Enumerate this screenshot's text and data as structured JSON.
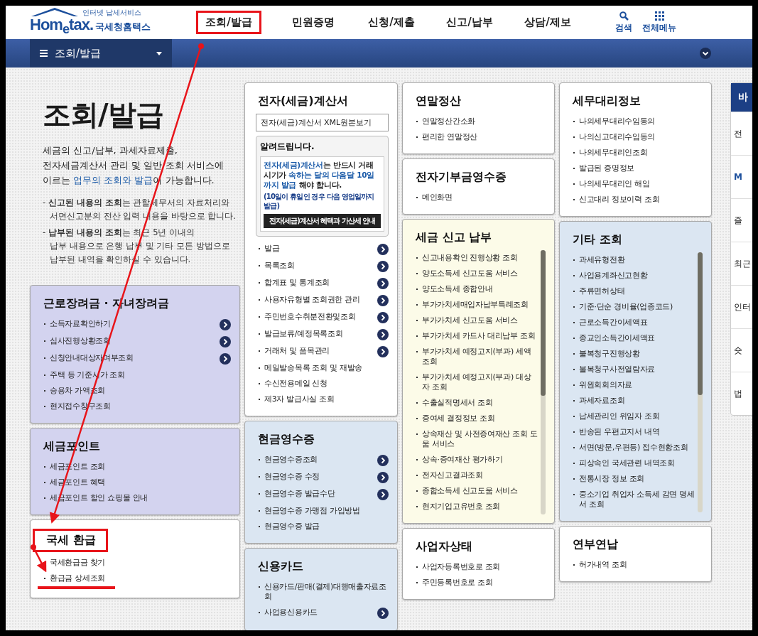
{
  "logo": {
    "tagline": "인터넷 납세서비스",
    "brand": "Hom$_{e}$tax.",
    "name": "국세청홈택스"
  },
  "nav": [
    {
      "label": "조회/발급",
      "annotated": true
    },
    {
      "label": "민원증명",
      "annotated": false
    },
    {
      "label": "신청/제출",
      "annotated": false
    },
    {
      "label": "신고/납부",
      "annotated": false
    },
    {
      "label": "상담/제보",
      "annotated": false
    }
  ],
  "tools": [
    {
      "kind": "search",
      "label": "검색"
    },
    {
      "kind": "menu",
      "label": "전체메뉴"
    }
  ],
  "subbar": {
    "title": "조회/발급"
  },
  "intro": {
    "title": "조회/발급",
    "description": [
      {
        "text": "세금의 신고/납부, 과세자료제출,\n전자세금계산서 관리 및 일반 조회 서비스에\n이르는 ",
        "accent": false
      },
      {
        "text": "업무의 조회와 발급",
        "accent": true
      },
      {
        "text": "이 가능합니다.",
        "accent": false
      }
    ],
    "notes": [
      {
        "marker": "-",
        "text": "**신고된 내용의 조회**는 관할세무서의 자료처리와\n서면신고분의 전산 입력 내용을 바탕으로 합니다."
      },
      {
        "marker": "-",
        "text": "**납부된 내용의 조회**는 최근 5년 이내의\n납부 내용으로 은행 납부 및 기타 모든 방법으로\n납부된 내역을 확인하실 수 있습니다."
      }
    ]
  },
  "columns": [
    [
      {
        "title": "근로장려금 · 자녀장려금",
        "color": "#d3d3ef",
        "annotated": false,
        "scroll": false,
        "items": [
          {
            "label": "소득자료확인하기",
            "arrow": true,
            "annotated": false
          },
          {
            "label": "심사진행상황조회",
            "arrow": true,
            "annotated": false
          },
          {
            "label": "신청안내대상자여부조회",
            "arrow": true,
            "annotated": false
          },
          {
            "label": "주택 등 기준시가 조회",
            "arrow": false,
            "annotated": false
          },
          {
            "label": "승용차 가액조회",
            "arrow": false,
            "annotated": false
          },
          {
            "label": "현지접수창구조회",
            "arrow": false,
            "annotated": false
          }
        ]
      },
      {
        "title": "세금포인트",
        "color": "#d3d3ef",
        "annotated": false,
        "scroll": false,
        "items": [
          {
            "label": "세금포인트 조회",
            "arrow": false,
            "annotated": false
          },
          {
            "label": "세금포인트 혜택",
            "arrow": false,
            "annotated": false
          },
          {
            "label": "세금포인트 할인 쇼핑몰 안내",
            "arrow": false,
            "annotated": false
          }
        ]
      },
      {
        "title": "국세 환급",
        "color": "#ffffff",
        "annotated": true,
        "scroll": false,
        "items": [
          {
            "label": "국세환급금 찾기",
            "arrow": false,
            "annotated": false
          },
          {
            "label": "환급금 상세조회",
            "arrow": false,
            "annotated": true
          }
        ]
      }
    ],
    [
      {
        "title": "전자(세금)계산서",
        "color": "#ffffff",
        "annotated": false,
        "scroll": false,
        "xml_button": "전자(세금)계산서 XML원본보기",
        "notice": {
          "title": "알려드립니다.",
          "body": [
            {
              "text": "전자(세금)계산서",
              "accent": true
            },
            {
              "text": "는 반드시 거래시기가 ",
              "accent": false
            },
            {
              "text": "속하는 달의 다음달 10일까지 발급",
              "accent": true
            },
            {
              "text": " 해야 합니다.",
              "accent": false
            }
          ],
          "note": "(10일이 휴일인 경우 다음 영업일까지 발급)",
          "button": "전자(세금)계산서 혜택과 가산세 안내"
        },
        "items": [
          {
            "label": "발급",
            "arrow": true,
            "annotated": false
          },
          {
            "label": "목록조회",
            "arrow": true,
            "annotated": false
          },
          {
            "label": "합계표 및 통계조회",
            "arrow": true,
            "annotated": false
          },
          {
            "label": "사용자유형별 조회권한 관리",
            "arrow": true,
            "annotated": false
          },
          {
            "label": "주민번호수취분전환및조회",
            "arrow": true,
            "annotated": false
          },
          {
            "label": "발급보류/예정목록조회",
            "arrow": true,
            "annotated": false
          },
          {
            "label": "거래처 및 품목관리",
            "arrow": true,
            "annotated": false
          },
          {
            "label": "메일발송목록 조회 및 재발송",
            "arrow": false,
            "annotated": false
          },
          {
            "label": "수신전용메일 신청",
            "arrow": false,
            "annotated": false
          },
          {
            "label": "제3자 발급사실 조회",
            "arrow": false,
            "annotated": false
          }
        ]
      },
      {
        "title": "현금영수증",
        "color": "#dbe6f2",
        "annotated": false,
        "scroll": false,
        "items": [
          {
            "label": "현금영수증조회",
            "arrow": true,
            "annotated": false
          },
          {
            "label": "현금영수증 수정",
            "arrow": true,
            "annotated": false
          },
          {
            "label": "현금영수증 발급수단",
            "arrow": true,
            "annotated": false
          },
          {
            "label": "현금영수증 가맹점 가입방법",
            "arrow": false,
            "annotated": false
          },
          {
            "label": "현금영수증 발급",
            "arrow": false,
            "annotated": false
          }
        ]
      },
      {
        "title": "신용카드",
        "color": "#dbe6f2",
        "annotated": false,
        "scroll": false,
        "items": [
          {
            "label": "신용카드/판매(결제)대행매출자료조회",
            "arrow": false,
            "annotated": false
          },
          {
            "label": "사업용신용카드",
            "arrow": true,
            "annotated": false
          }
        ]
      }
    ],
    [
      {
        "title": "연말정산",
        "color": "#ffffff",
        "annotated": false,
        "scroll": false,
        "items": [
          {
            "label": "연말정산간소화",
            "arrow": false,
            "annotated": false
          },
          {
            "label": "편리한 연말정산",
            "arrow": false,
            "annotated": false
          }
        ]
      },
      {
        "title": "전자기부금영수증",
        "color": "#ffffff",
        "annotated": false,
        "scroll": false,
        "items": [
          {
            "label": "메인화면",
            "arrow": false,
            "annotated": false
          }
        ]
      },
      {
        "title": "세금 신고 납부",
        "color": "#fcfbe8",
        "annotated": false,
        "scroll": true,
        "items": [
          {
            "label": "신고내용확인 진행상황 조회",
            "arrow": false,
            "annotated": false
          },
          {
            "label": "양도소득세 신고도움 서비스",
            "arrow": false,
            "annotated": false
          },
          {
            "label": "양도소득세 종합안내",
            "arrow": false,
            "annotated": false
          },
          {
            "label": "부가가치세매입자납부특례조회",
            "arrow": false,
            "annotated": false
          },
          {
            "label": "부가가치세 신고도움 서비스",
            "arrow": false,
            "annotated": false
          },
          {
            "label": "부가가치세 카드사 대리납부 조회",
            "arrow": false,
            "annotated": false
          },
          {
            "label": "부가가치세 예정고지(부과) 세액조회",
            "arrow": false,
            "annotated": false
          },
          {
            "label": "부가가치세 예정고지(부과) 대상자 조회",
            "arrow": false,
            "annotated": false
          },
          {
            "label": "수출실적명세서 조회",
            "arrow": false,
            "annotated": false
          },
          {
            "label": "증여세 결정정보 조회",
            "arrow": false,
            "annotated": false
          },
          {
            "label": "상속재산 및 사전증여재산 조회 도움 서비스",
            "arrow": false,
            "annotated": false
          },
          {
            "label": "상속·증여재산 평가하기",
            "arrow": false,
            "annotated": false
          },
          {
            "label": "전자신고결과조회",
            "arrow": false,
            "annotated": false
          },
          {
            "label": "종합소득세 신고도움 서비스",
            "arrow": false,
            "annotated": false
          },
          {
            "label": "현지기업고유번호 조회",
            "arrow": false,
            "annotated": false
          }
        ]
      },
      {
        "title": "사업자상태",
        "color": "#ffffff",
        "annotated": false,
        "scroll": false,
        "items": [
          {
            "label": "사업자등록번호로 조회",
            "arrow": false,
            "annotated": false
          },
          {
            "label": "주민등록번호로 조회",
            "arrow": false,
            "annotated": false
          }
        ]
      }
    ],
    [
      {
        "title": "세무대리정보",
        "color": "#ffffff",
        "annotated": false,
        "scroll": false,
        "items": [
          {
            "label": "나의세무대리수임동의",
            "arrow": false,
            "annotated": false
          },
          {
            "label": "나의신고대리수임동의",
            "arrow": false,
            "annotated": false
          },
          {
            "label": "나의세무대리인조회",
            "arrow": false,
            "annotated": false
          },
          {
            "label": "발급된 증명정보",
            "arrow": false,
            "annotated": false
          },
          {
            "label": "나의세무대리인 해임",
            "arrow": false,
            "annotated": false
          },
          {
            "label": "신고대리 정보이력 조회",
            "arrow": false,
            "annotated": false
          }
        ]
      },
      {
        "title": "기타 조회",
        "color": "#dbe6f2",
        "annotated": false,
        "scroll": true,
        "items": [
          {
            "label": "과세유형전환",
            "arrow": false,
            "annotated": false
          },
          {
            "label": "사업용계좌신고현황",
            "arrow": false,
            "annotated": false
          },
          {
            "label": "주류면허상태",
            "arrow": false,
            "annotated": false
          },
          {
            "label": "기준·단순 경비율(업종코드)",
            "arrow": false,
            "annotated": false
          },
          {
            "label": "근로소득간이세액표",
            "arrow": false,
            "annotated": false
          },
          {
            "label": "종교인소득간이세액표",
            "arrow": false,
            "annotated": false
          },
          {
            "label": "불복청구진행상황",
            "arrow": false,
            "annotated": false
          },
          {
            "label": "불복청구사전열람자료",
            "arrow": false,
            "annotated": false
          },
          {
            "label": "위원회회의자료",
            "arrow": false,
            "annotated": false
          },
          {
            "label": "과세자료조회",
            "arrow": false,
            "annotated": false
          },
          {
            "label": "납세관리인 위임자 조회",
            "arrow": false,
            "annotated": false
          },
          {
            "label": "반송된 우편고지서 내역",
            "arrow": false,
            "annotated": false
          },
          {
            "label": "서면(방문,우편등) 접수현황조회",
            "arrow": false,
            "annotated": false
          },
          {
            "label": "피상속인 국세관련 내역조회",
            "arrow": false,
            "annotated": false
          },
          {
            "label": "전통시장 정보 조회",
            "arrow": false,
            "annotated": false
          },
          {
            "label": "중소기업 취업자 소득세 감면 명세서 조회",
            "arrow": false,
            "annotated": false
          }
        ]
      },
      {
        "title": "연부연납",
        "color": "#ffffff",
        "annotated": false,
        "scroll": false,
        "items": [
          {
            "label": "허가내역 조회",
            "arrow": false,
            "annotated": false
          }
        ]
      }
    ]
  ],
  "side_panel": {
    "header": "바",
    "items": [
      {
        "text": "전",
        "accent": false
      },
      {
        "text": "M",
        "accent": true
      },
      {
        "text": "즐",
        "accent": false
      },
      {
        "text": "최근",
        "accent": false
      },
      {
        "text": "인터",
        "accent": false
      },
      {
        "text": "숏",
        "accent": false
      },
      {
        "text": "법",
        "accent": false
      }
    ]
  }
}
